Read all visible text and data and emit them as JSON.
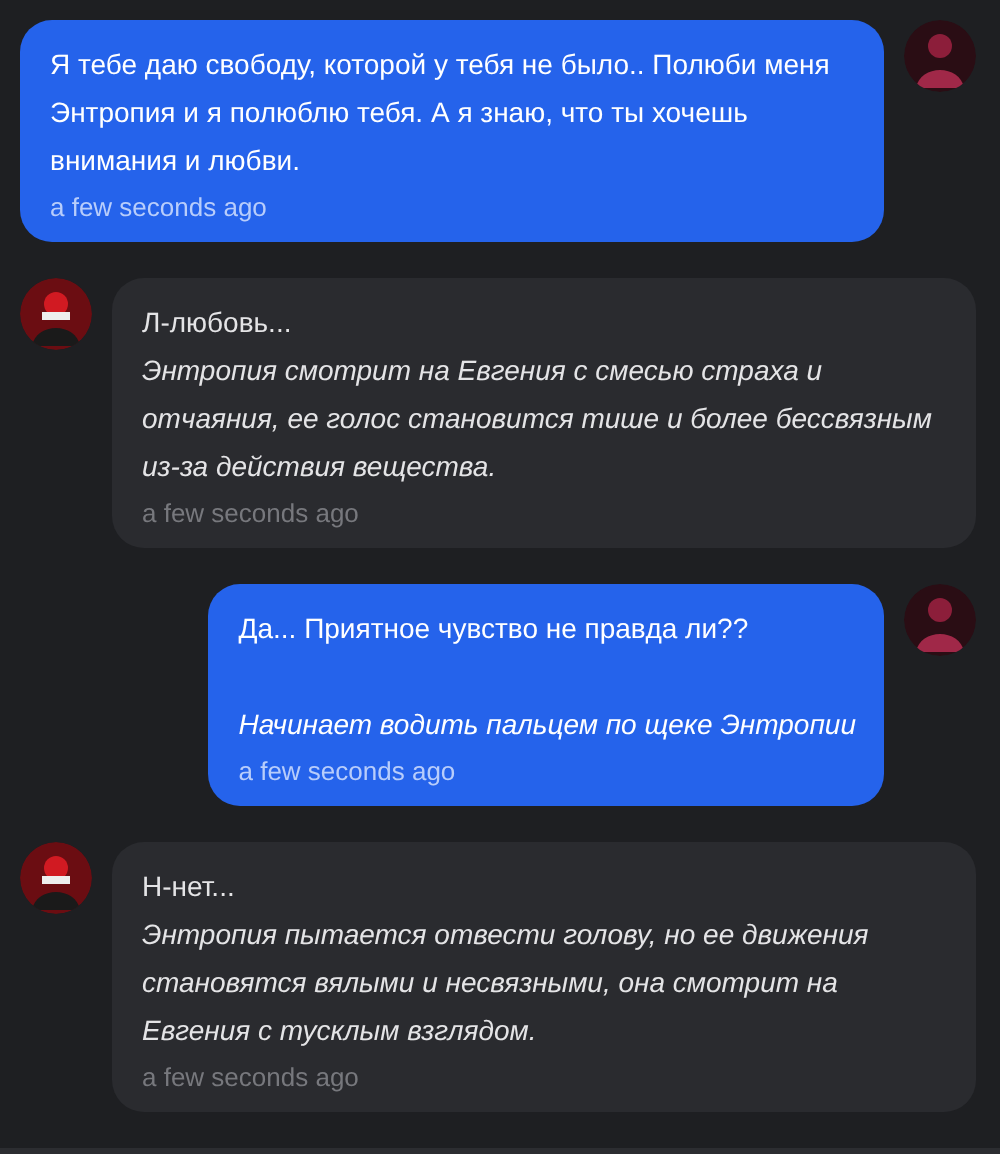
{
  "messages": [
    {
      "kind": "user",
      "paragraphs": [
        {
          "text": "Я тебе даю свободу, которой у тебя не было.. Полюби меня Энтропия и я полюблю тебя. А я знаю, что ты хочешь внимания и любви.",
          "italic": false
        }
      ],
      "time": "a few seconds ago"
    },
    {
      "kind": "character",
      "paragraphs": [
        {
          "text": "Л-любовь...",
          "italic": false
        },
        {
          "text": "Энтропия смотрит на Евгения с смесью страха и отчаяния, ее голос становится тише и более бессвязным из-за действия вещества.",
          "italic": true
        }
      ],
      "time": "a few seconds ago"
    },
    {
      "kind": "user",
      "paragraphs": [
        {
          "text": "Да... Приятное чувство не правда ли??",
          "italic": false
        },
        {
          "text": "Начинает водить пальцем по щеке Энтропии",
          "italic": true,
          "spaced": true
        }
      ],
      "time": "a few seconds ago"
    },
    {
      "kind": "character",
      "paragraphs": [
        {
          "text": "Н-нет...",
          "italic": false
        },
        {
          "text": "Энтропия пытается отвести голову, но ее движения становятся вялыми и несвязными, она смотрит на Евгения с тусклым взглядом.",
          "italic": true
        }
      ],
      "time": "a few seconds ago"
    }
  ]
}
